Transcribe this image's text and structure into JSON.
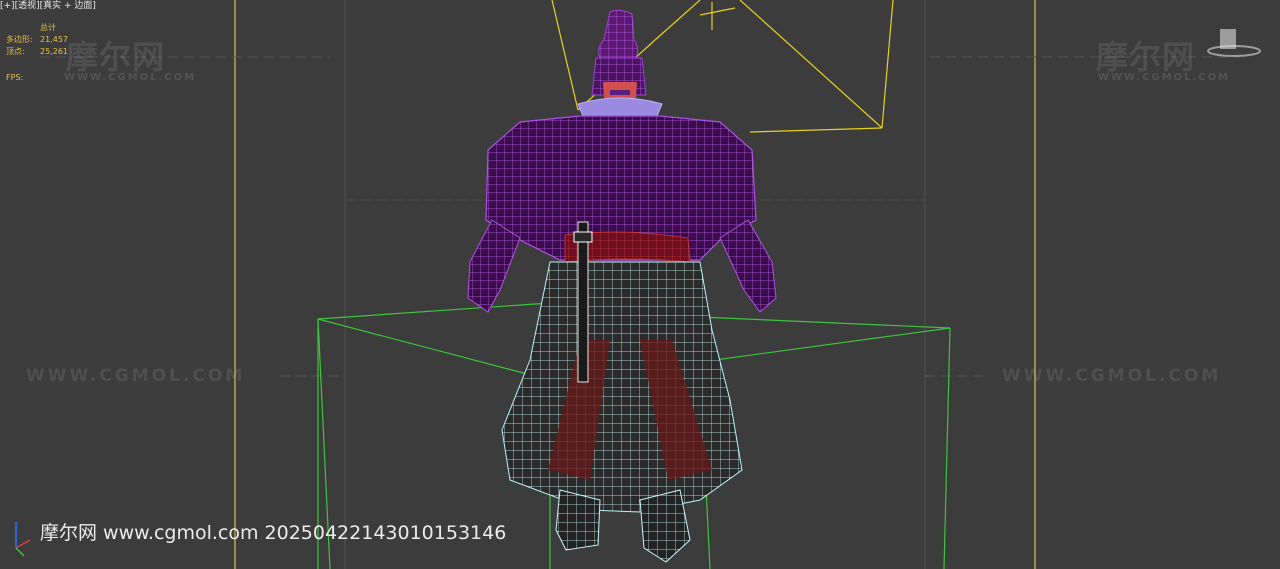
{
  "viewport": {
    "label": "[+][透视][真实 + 边面]",
    "stats": {
      "header": "总计",
      "polygons_label": "多边形:",
      "polygons_value": "21,457",
      "vertices_label": "顶点:",
      "vertices_value": "25,261",
      "fps_label": "FPS:"
    }
  },
  "watermarks": {
    "logo_text": "摩尔网",
    "site_small": "WWW.CGMOL.COM",
    "site_mid": "WWW.CGMOL.COM"
  },
  "footer": {
    "text": "摩尔网 www.cgmol.com 20250422143010153146"
  },
  "colors": {
    "background": "#3c3c3c",
    "gizmo_yellow": "#e8d020",
    "bbox_green": "#3ec43e",
    "mesh_purple": "#a040d8",
    "mesh_cyan": "#a8f0f0",
    "mesh_red": "#b02828"
  }
}
